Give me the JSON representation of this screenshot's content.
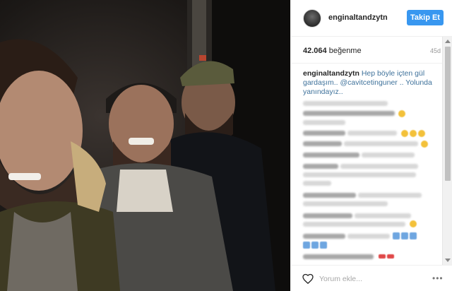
{
  "post": {
    "username": "enginaltandzytn",
    "follow_label": "Takip Et",
    "likes_count": "42.064",
    "likes_label": "beğenme",
    "age": "45d",
    "caption_user": "enginaltandzytn",
    "caption_text": "Hep böyle içten gül gardaşım.. @cavitcetinguner .. Yolunda yanındayız..",
    "comment_placeholder": "Yorum ekle...",
    "more_label": "•••"
  },
  "icons": {
    "avatar": "profile-avatar",
    "heart": "heart-icon",
    "more": "more-options-icon"
  },
  "colors": {
    "follow_button": "#3897f0",
    "mention": "#3f729b"
  }
}
